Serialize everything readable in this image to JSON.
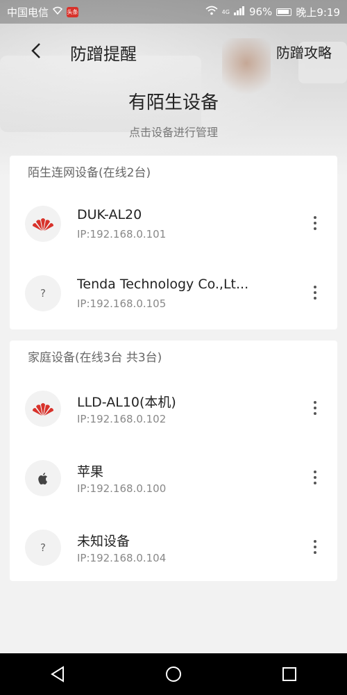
{
  "status_bar": {
    "carrier": "中国电信",
    "network": "4G",
    "battery": "96%",
    "time": "晚上9:19",
    "app_badge_text": "头条"
  },
  "app_bar": {
    "title": "防蹭提醒",
    "guide_link": "防蹭攻略"
  },
  "hero": {
    "headline": "有陌生设备",
    "subline": "点击设备进行管理"
  },
  "sections": [
    {
      "header": "陌生连网设备(在线2台)",
      "devices": [
        {
          "name": "DUK-AL20",
          "ip": "IP:192.168.0.101",
          "icon": "huawei-logo-icon"
        },
        {
          "name": "Tenda Technology Co.,Lt...",
          "ip": "IP:192.168.0.105",
          "icon": "unknown-device-icon",
          "glyph": "?"
        }
      ]
    },
    {
      "header": "家庭设备(在线3台 共3台)",
      "devices": [
        {
          "name": "LLD-AL10(本机)",
          "ip": "IP:192.168.0.102",
          "icon": "huawei-logo-icon"
        },
        {
          "name": "苹果",
          "ip": "IP:192.168.0.100",
          "icon": "apple-logo-icon"
        },
        {
          "name": "未知设备",
          "ip": "IP:192.168.0.104",
          "icon": "unknown-device-icon",
          "glyph": "?"
        }
      ]
    }
  ],
  "colors": {
    "huawei_red": "#d8322b",
    "background": "#f2f2f2",
    "card": "#ffffff",
    "nav_bar": "#000000"
  },
  "nav": {
    "back_icon": "triangle-back-icon",
    "home_icon": "circle-home-icon",
    "recents_icon": "square-recents-icon"
  }
}
